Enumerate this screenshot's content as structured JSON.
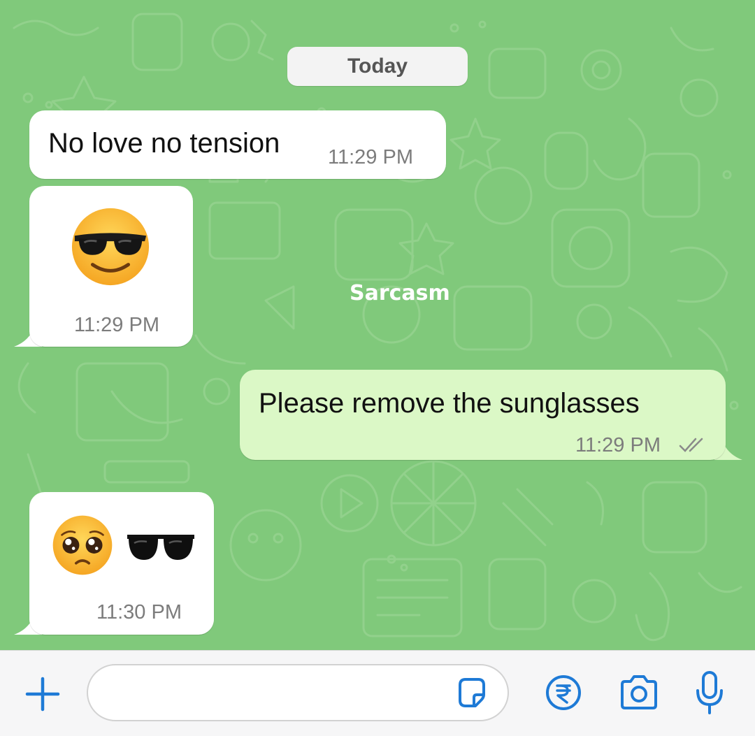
{
  "date_label": "Today",
  "watermark": "Sarcasm",
  "messages": [
    {
      "direction": "incoming",
      "text": "No love no tension",
      "time": "11:29 PM"
    },
    {
      "direction": "incoming",
      "emoji": "smiling-face-with-sunglasses",
      "time": "11:29 PM"
    },
    {
      "direction": "outgoing",
      "text": "Please remove the sunglasses",
      "time": "11:29 PM",
      "status": "read"
    },
    {
      "direction": "incoming",
      "emoji": [
        "pleading-face",
        "sunglasses"
      ],
      "time": "11:30 PM"
    }
  ],
  "composer": {
    "placeholder": "",
    "icons": [
      "plus-icon",
      "sticker-icon",
      "rupee-payment-icon",
      "camera-icon",
      "microphone-icon"
    ]
  },
  "colors": {
    "chat_background": "#80c97b",
    "incoming_bubble": "#ffffff",
    "outgoing_bubble": "#dbf8c6",
    "accent_blue": "#1e7ad6",
    "timestamp": "#7c7c7c"
  }
}
